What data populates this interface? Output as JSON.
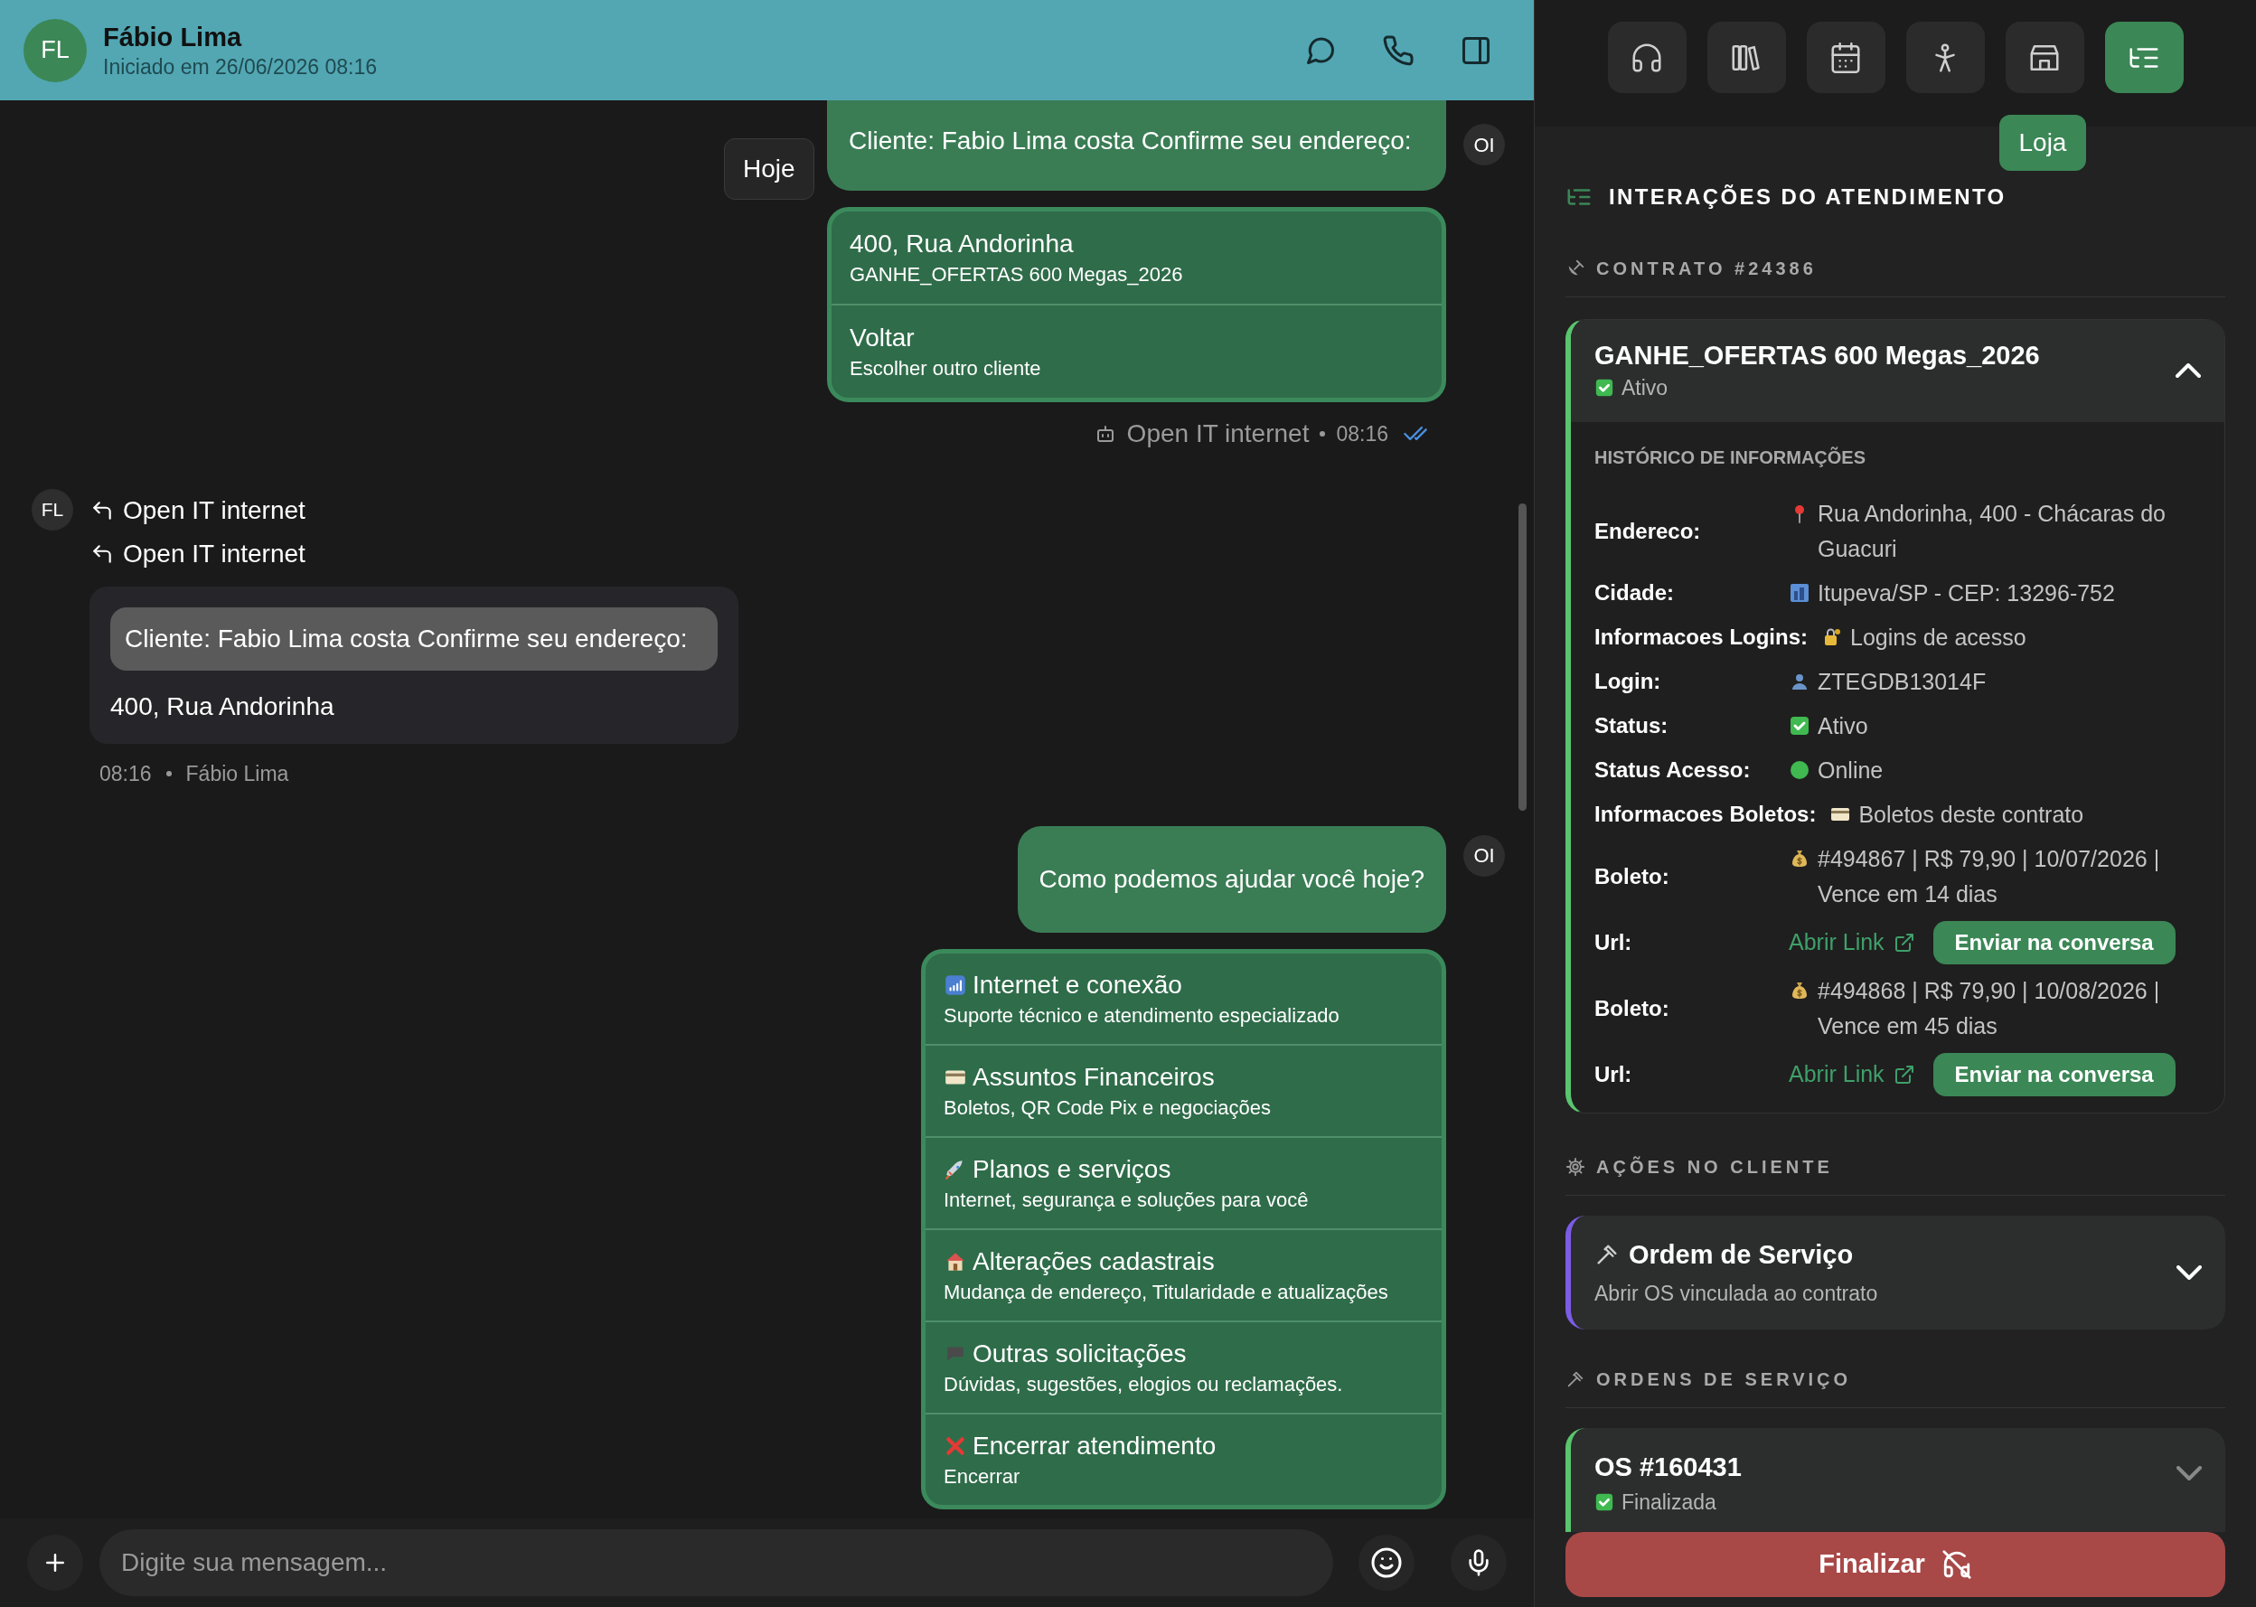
{
  "header": {
    "avatar": "FL",
    "name": "Fábio Lima",
    "subtitle": "Iniciado em 26/06/2026 08:16"
  },
  "chat": {
    "date_badge": "Hoje",
    "messages": [
      {
        "kind": "outgoing",
        "avatar": "OI",
        "text": "Cliente: Fabio Lima costa Confirme seu endereço:"
      },
      {
        "kind": "options",
        "options": [
          {
            "title": "400, Rua Andorinha",
            "subtitle": "GANHE_OFERTAS 600 Megas_2026"
          },
          {
            "title": "Voltar",
            "subtitle": "Escolher outro cliente"
          }
        ],
        "meta": {
          "sender": "Open IT internet",
          "time": "08:16"
        }
      },
      {
        "kind": "incoming",
        "avatar": "FL",
        "replies": [
          "Open IT internet",
          "Open IT internet"
        ],
        "quote": "Cliente: Fabio Lima costa Confirme seu endereço:",
        "text": "400, Rua Andorinha",
        "meta": {
          "time": "08:16",
          "sender": "Fábio Lima"
        }
      },
      {
        "kind": "outgoing",
        "avatar": "OI",
        "text": "Como podemos ajudar você hoje?"
      },
      {
        "kind": "options",
        "options": [
          {
            "title": "Internet e conexão",
            "subtitle": "Suporte técnico e atendimento especializado"
          },
          {
            "title": "Assuntos Financeiros",
            "subtitle": "Boletos, QR Code Pix e negociações"
          },
          {
            "title": "Planos e serviços",
            "subtitle": "Internet, segurança e soluções para você"
          },
          {
            "title": "Alterações cadastrais",
            "subtitle": "Mudança de endereço, Titularidade e atualizações"
          },
          {
            "title": "Outras solicitações",
            "subtitle": "Dúvidas, sugestões, elogios ou reclamações."
          },
          {
            "title": "Encerrar atendimento",
            "subtitle": "Encerrar"
          }
        ]
      }
    ]
  },
  "composer": {
    "placeholder": "Digite sua mensagem..."
  },
  "toolbar": {
    "buttons": [
      {
        "selected": false
      },
      {
        "selected": false
      },
      {
        "selected": false
      },
      {
        "selected": false
      },
      {
        "selected": false,
        "tooltip": "Loja"
      },
      {
        "selected": true
      }
    ]
  },
  "panel": {
    "title": "INTERAÇÕES DO ATENDIMENTO",
    "contract": {
      "heading": "CONTRATO #24386",
      "name": "GANHE_OFERTAS 600 Megas_2026",
      "status": "Ativo",
      "expanded": true,
      "history_title": "HISTÓRICO DE INFORMAÇÕES",
      "rows": [
        {
          "kind": "text",
          "label": "Endereco:",
          "value": "Rua Andorinha, 400 - Chácaras do Guacuri"
        },
        {
          "kind": "text",
          "label": "Cidade:",
          "value": "Itupeva/SP - CEP: 13296-752"
        },
        {
          "kind": "text",
          "label": "Informacoes Logins:",
          "value": "Logins de acesso"
        },
        {
          "kind": "text",
          "label": "Login:",
          "value": "ZTEGDB13014F"
        },
        {
          "kind": "text",
          "label": "Status:",
          "value": "Ativo"
        },
        {
          "kind": "text",
          "label": "Status Acesso:",
          "value": "Online"
        },
        {
          "kind": "text",
          "label": "Informacoes Boletos:",
          "value": "Boletos deste contrato"
        },
        {
          "kind": "text",
          "label": "Boleto:",
          "value": "#494867 | R$ 79,90 | 10/07/2026 | Vence em 14 dias"
        },
        {
          "kind": "link",
          "label": "Url:",
          "link": "Abrir Link",
          "button": "Enviar na conversa"
        },
        {
          "kind": "text",
          "label": "Boleto:",
          "value": "#494868 | R$ 79,90 | 10/08/2026 | Vence em 45 dias"
        },
        {
          "kind": "link",
          "label": "Url:",
          "link": "Abrir Link",
          "button": "Enviar na conversa"
        }
      ]
    },
    "actions": {
      "heading": "AÇÕES NO CLIENTE",
      "cards": [
        {
          "title": "Ordem de Serviço",
          "subtitle": "Abrir OS vinculada ao contrato",
          "expanded": false
        }
      ]
    },
    "orders": {
      "heading": "ORDENS DE SERVIÇO",
      "items": [
        {
          "title": "OS #160431",
          "status": "Finalizada",
          "expanded": false
        }
      ]
    },
    "finish_button": "Finalizar"
  }
}
